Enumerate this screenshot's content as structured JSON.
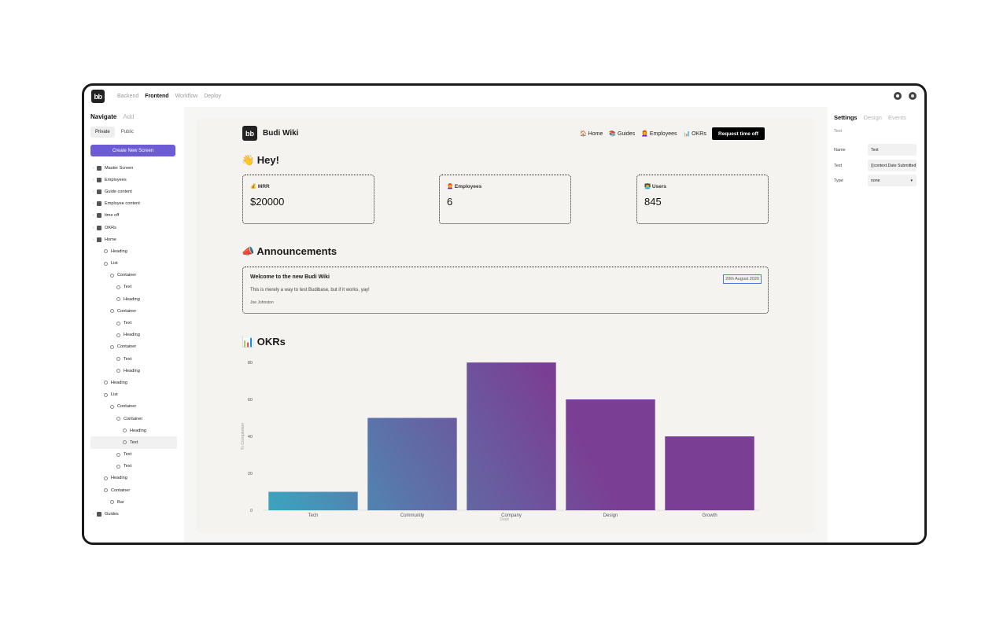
{
  "topbar": {
    "logo_text": "bb",
    "tabs": [
      "Backend",
      "Frontend",
      "Workflow",
      "Deploy"
    ]
  },
  "sidebar": {
    "navigate_label": "Navigate",
    "add_label": "Add",
    "private_label": "Private",
    "public_label": "Public",
    "create_label": "Create New Screen",
    "tree": [
      {
        "label": "Master Screen",
        "depth": 0,
        "kind": "screen"
      },
      {
        "label": "Employees",
        "depth": 0,
        "kind": "screen"
      },
      {
        "label": "Guide content",
        "depth": 0,
        "kind": "screen"
      },
      {
        "label": "Employee content",
        "depth": 0,
        "kind": "screen"
      },
      {
        "label": "time off",
        "depth": 0,
        "kind": "screen"
      },
      {
        "label": "OKRs",
        "depth": 0,
        "kind": "screen"
      },
      {
        "label": "Home",
        "depth": 0,
        "kind": "screen"
      },
      {
        "label": "Heading",
        "depth": 1,
        "kind": "comp"
      },
      {
        "label": "List",
        "depth": 1,
        "kind": "comp"
      },
      {
        "label": "Container",
        "depth": 2,
        "kind": "comp"
      },
      {
        "label": "Text",
        "depth": 3,
        "kind": "comp"
      },
      {
        "label": "Heading",
        "depth": 3,
        "kind": "comp"
      },
      {
        "label": "Container",
        "depth": 2,
        "kind": "comp"
      },
      {
        "label": "Text",
        "depth": 3,
        "kind": "comp"
      },
      {
        "label": "Heading",
        "depth": 3,
        "kind": "comp"
      },
      {
        "label": "Container",
        "depth": 2,
        "kind": "comp"
      },
      {
        "label": "Text",
        "depth": 3,
        "kind": "comp"
      },
      {
        "label": "Heading",
        "depth": 3,
        "kind": "comp"
      },
      {
        "label": "Heading",
        "depth": 1,
        "kind": "comp"
      },
      {
        "label": "List",
        "depth": 1,
        "kind": "comp"
      },
      {
        "label": "Container",
        "depth": 2,
        "kind": "comp"
      },
      {
        "label": "Container",
        "depth": 3,
        "kind": "comp"
      },
      {
        "label": "Heading",
        "depth": 4,
        "kind": "comp"
      },
      {
        "label": "Text",
        "depth": 4,
        "kind": "comp",
        "selected": true
      },
      {
        "label": "Text",
        "depth": 3,
        "kind": "comp"
      },
      {
        "label": "Text",
        "depth": 3,
        "kind": "comp"
      },
      {
        "label": "Heading",
        "depth": 1,
        "kind": "comp"
      },
      {
        "label": "Container",
        "depth": 1,
        "kind": "comp"
      },
      {
        "label": "Bar",
        "depth": 2,
        "kind": "comp"
      },
      {
        "label": "Guides",
        "depth": 0,
        "kind": "screen"
      }
    ]
  },
  "app": {
    "logo_text": "bb",
    "title": "Budi Wiki",
    "nav": [
      "🏠 Home",
      "📚 Guides",
      "👩‍🦰 Employees",
      "📊 OKRs"
    ],
    "request_label": "Request time off",
    "hey_title": "👋 Hey!",
    "stats": [
      {
        "label": "💰 MRR",
        "value": "$20000"
      },
      {
        "label": "👩‍🦰 Employees",
        "value": "6"
      },
      {
        "label": "👨‍💻 Users",
        "value": "845"
      }
    ],
    "announcements_title": "📣 Announcements",
    "announcement": {
      "title": "Welcome to the new Budi Wiki",
      "body": "This is merely a way to test Budibase, but if it works, yay!",
      "author": "Joe Johnston",
      "date": "20th August 2020"
    },
    "okrs_title": "📊 OKRs"
  },
  "chart_data": {
    "type": "bar",
    "categories": [
      "Tech",
      "Community",
      "Company",
      "Design",
      "Growth"
    ],
    "values": [
      10,
      50,
      80,
      60,
      40
    ],
    "xlabel": "Dept",
    "ylabel": "% Completion",
    "ylim": [
      0,
      80
    ],
    "yticks": [
      0,
      20,
      40,
      60,
      80
    ],
    "colors": {
      "start": "#3aa6bf",
      "mid": "#5c72a8",
      "end": "#7a3f94"
    }
  },
  "rpanel": {
    "tabs": [
      "Settings",
      "Design",
      "Events"
    ],
    "type_label": "Text",
    "fields": [
      {
        "key": "Name",
        "value": "Text"
      },
      {
        "key": "Text",
        "value": "{{context.Date Submitted}}"
      },
      {
        "key": "Type",
        "value": "none"
      }
    ]
  }
}
